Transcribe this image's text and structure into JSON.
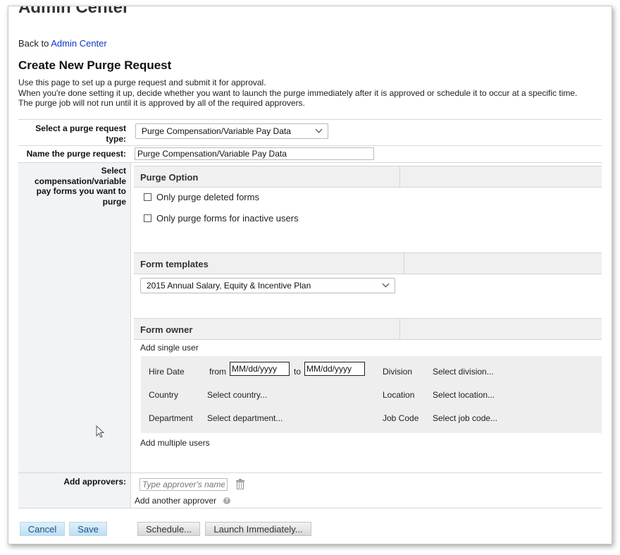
{
  "header": {
    "app_title": "Admin Center",
    "back_prefix": "Back to ",
    "back_link": "Admin Center"
  },
  "page": {
    "title": "Create New Purge Request",
    "description": [
      "Use this page to set up a purge request and submit it for approval.",
      "When you're done setting it up, decide whether you want to launch the purge immediately after it is approved or schedule it to occur at a specific time.",
      "The purge job will not run until it is approved by all of the required approvers."
    ]
  },
  "form": {
    "type_label_1": "Select a purge request",
    "type_label_2": "type:",
    "type_value": "Purge Compensation/Variable Pay Data",
    "name_label": "Name the purge request:",
    "name_value": "Purge Compensation/Variable Pay Data",
    "forms_label": [
      "Select",
      "compensation/variable",
      "pay forms you want to",
      "purge"
    ],
    "approvers_label": "Add approvers:"
  },
  "purge_option": {
    "heading": "Purge Option",
    "options": [
      {
        "label": "Only purge deleted forms",
        "checked": false
      },
      {
        "label": "Only purge forms for inactive users",
        "checked": false
      }
    ]
  },
  "form_templates": {
    "heading": "Form templates",
    "selected": "2015 Annual Salary, Equity & Incentive Plan"
  },
  "form_owner": {
    "heading": "Form owner",
    "add_single": "Add single user",
    "add_multiple": "Add multiple users",
    "hire_date_label": "Hire Date",
    "from_label": "from",
    "to_label": "to",
    "from_value": "MM/dd/yyyy",
    "to_value": "MM/dd/yyyy",
    "division_label": "Division",
    "division_link": "Select division...",
    "country_label": "Country",
    "country_link": "Select country...",
    "location_label": "Location",
    "location_link": "Select location...",
    "department_label": "Department",
    "department_link": "Select department...",
    "jobcode_label": "Job Code",
    "jobcode_link": "Select job code..."
  },
  "approvers": {
    "placeholder": "Type approver's name",
    "add_another": "Add another approver",
    "help_glyph": "?"
  },
  "buttons": {
    "cancel": "Cancel",
    "save": "Save",
    "schedule": "Schedule...",
    "launch": "Launch Immediately..."
  },
  "colors": {
    "link": "#0d36c9",
    "teal_link": "#1a7aa8",
    "button_blue": "#bfdff3",
    "section_bg": "#f0f0f0",
    "left_panel_bg": "#f2f3f6"
  },
  "icons": {
    "trash": "trash-icon",
    "help": "help-icon",
    "cursor": "mouse-pointer-icon",
    "dropdown": "chevron-down-icon"
  }
}
